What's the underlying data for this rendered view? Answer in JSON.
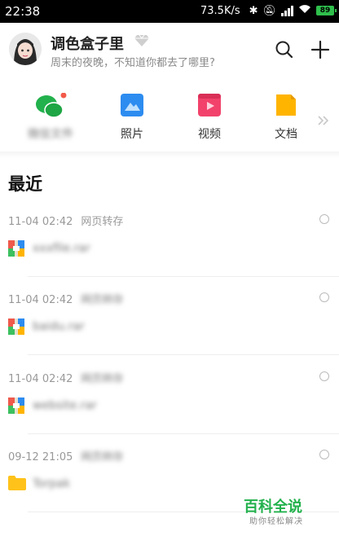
{
  "status_bar": {
    "time": "22:38",
    "net_speed": "73.5K/s",
    "battery": "89"
  },
  "header": {
    "username": "调色盒子里",
    "subtitle": "周末的夜晚，不知道你都去了哪里?",
    "vip_icon": "diamond-icon",
    "search_icon": "search-icon",
    "add_icon": "plus-icon"
  },
  "categories": [
    {
      "label": "微信文件",
      "icon": "wechat-icon",
      "color": "#22b14c",
      "blurred": true,
      "has_badge": true
    },
    {
      "label": "照片",
      "icon": "photo-icon",
      "color": "#2d8cf0"
    },
    {
      "label": "视频",
      "icon": "video-icon",
      "color": "#f2426b"
    },
    {
      "label": "文档",
      "icon": "document-icon",
      "color": "#ffb400"
    }
  ],
  "section": {
    "title": "最近"
  },
  "recent_items": [
    {
      "date": "11-04 02:42",
      "source": "网页转存",
      "name": "xxxfile.rar",
      "icon": "archive-icon"
    },
    {
      "date": "11-04 02:42",
      "source": "网页转存",
      "name": "baidu.rar",
      "icon": "archive-icon"
    },
    {
      "date": "11-04 02:42",
      "source": "网页转存",
      "name": "website.rar",
      "icon": "archive-icon"
    },
    {
      "date": "09-12 21:05",
      "source": "网页转存",
      "name": "Torpak",
      "icon": "folder-icon"
    }
  ],
  "watermark": {
    "title": "百科全说",
    "subtitle": "助你轻松解决"
  }
}
